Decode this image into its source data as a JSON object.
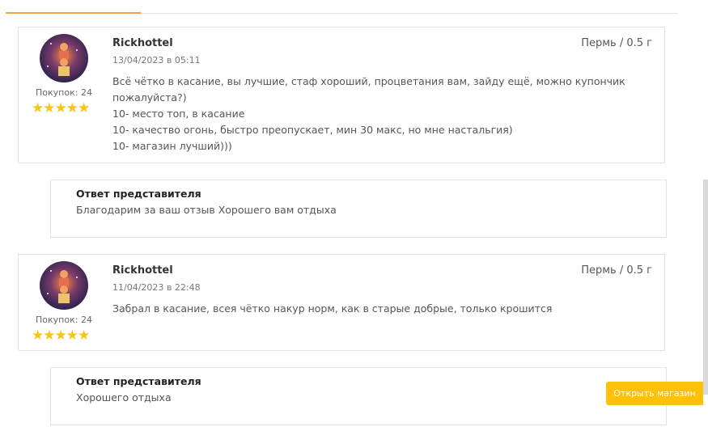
{
  "reviews": [
    {
      "author": "Rickhottel",
      "date": "13/04/2023 в 05:11",
      "location": "Пермь / 0.5 г",
      "purchases": "Покупок: 24",
      "stars": "★★★★★",
      "rating": 5,
      "text_lines": [
        "Всё чётко в касание, вы лучшие, стаф хороший, процветания вам, зайду ещё, можно купончик",
        "пожалуйста?)",
        "10- место топ, в касание",
        "10- качество огонь, быстро преопускает, мин 30 макс, но мне настальгия)",
        "10- магазин лучший)))"
      ],
      "reply": {
        "title": "Ответ представителя",
        "text": "Благодарим за ваш отзыв Хорошего вам отдыха"
      }
    },
    {
      "author": "Rickhottel",
      "date": "11/04/2023 в 22:48",
      "location": "Пермь / 0.5 г",
      "purchases": "Покупок: 24",
      "stars": "★★★★★",
      "rating": 5,
      "text_lines": [
        "Забрал в касание, всея чётко накур норм, как в старые добрые, только крошится"
      ],
      "reply": {
        "title": "Ответ представителя",
        "text": "Хорошего отдыха"
      }
    }
  ],
  "open_shop_button": "Открыть магазин",
  "colors": {
    "accent": "#ffc107",
    "star": "#f5c518",
    "tab_underline": "#f0a04b",
    "border": "#e2e2e2"
  }
}
